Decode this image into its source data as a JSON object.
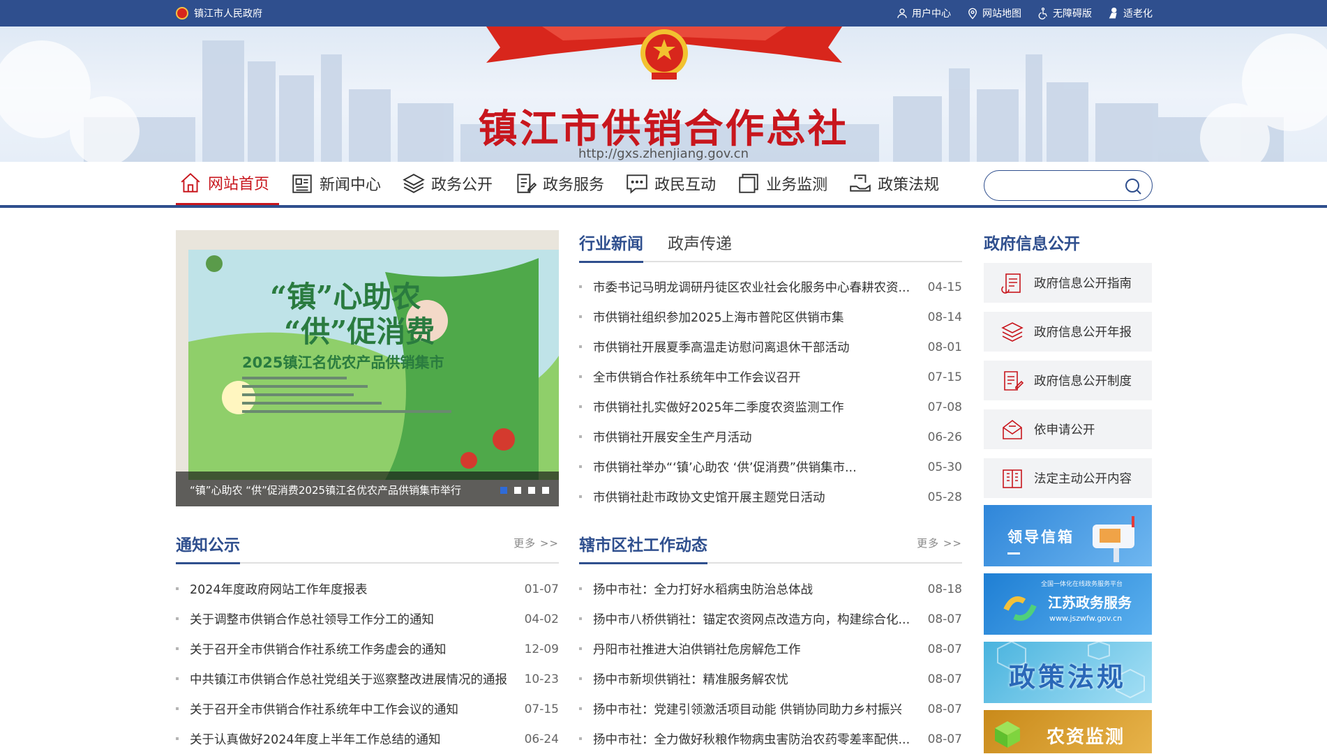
{
  "topbar": {
    "gov_label": "镇江市人民政府",
    "links": [
      "用户中心",
      "网站地图",
      "无障碍版",
      "适老化"
    ]
  },
  "banner": {
    "title": "镇江市供销合作总社",
    "url": "http://gxs.zhenjiang.gov.cn"
  },
  "nav": {
    "items": [
      "网站首页",
      "新闻中心",
      "政务公开",
      "政务服务",
      "政民互动",
      "业务监测",
      "政策法规"
    ],
    "search_placeholder": ""
  },
  "carousel": {
    "caption": "“镇”心助农 “供”促消费2025镇江名优农产品供销集市举行",
    "poster_line1": "“镇”心助农",
    "poster_line2": "“供”促消费",
    "poster_line3": "2025镇江名优农产品供销集市",
    "active_slide": 1,
    "slide_count": 4
  },
  "news": {
    "tabs": [
      "行业新闻",
      "政声传递"
    ],
    "items": [
      {
        "title": "市委书记马明龙调研丹徒区农业社会化服务中心春耕农资...",
        "date": "04-15"
      },
      {
        "title": "市供销社组织参加2025上海市普陀区供销市集",
        "date": "08-14"
      },
      {
        "title": "市供销社开展夏季高温走访慰问离退休干部活动",
        "date": "08-01"
      },
      {
        "title": "全市供销合作社系统年中工作会议召开",
        "date": "07-15"
      },
      {
        "title": "市供销社扎实做好2025年二季度农资监测工作",
        "date": "07-08"
      },
      {
        "title": "市供销社开展安全生产月活动",
        "date": "06-26"
      },
      {
        "title": "市供销社举办“‘镇’心助农 ‘供’促消费”供销集市...",
        "date": "05-30"
      },
      {
        "title": "市供销社赴市政协文史馆开展主题党日活动",
        "date": "05-28"
      }
    ]
  },
  "notices": {
    "title": "通知公示",
    "more": "更多 >>",
    "items": [
      {
        "title": "2024年度政府网站工作年度报表",
        "date": "01-07"
      },
      {
        "title": "关于调整市供销合作总社领导工作分工的通知",
        "date": "04-02"
      },
      {
        "title": "关于召开全市供销合作社系统工作务虚会的通知",
        "date": "12-09"
      },
      {
        "title": "中共镇江市供销合作总社党组关于巡察整改进展情况的通报",
        "date": "10-23"
      },
      {
        "title": "关于召开全市供销合作社系统年中工作会议的通知",
        "date": "07-15"
      },
      {
        "title": "关于认真做好2024年度上半年工作总结的通知",
        "date": "06-24"
      }
    ]
  },
  "district": {
    "title": "辖市区社工作动态",
    "more": "更多 >>",
    "items": [
      {
        "title": "扬中市社：全力打好水稻病虫防治总体战",
        "date": "08-18"
      },
      {
        "title": "扬中市八桥供销社：锚定农资网点改造方向，构建综合化...",
        "date": "08-07"
      },
      {
        "title": "丹阳市社推进大泊供销社危房解危工作",
        "date": "08-07"
      },
      {
        "title": "扬中市新坝供销社：精准服务解农忧",
        "date": "08-07"
      },
      {
        "title": "扬中市社：党建引领激活项目动能 供销协同助力乡村振兴",
        "date": "08-07"
      },
      {
        "title": "扬中市社：全力做好秋粮作物病虫害防治农药零差率配供...",
        "date": "08-07"
      }
    ]
  },
  "gov_info": {
    "title": "政府信息公开",
    "links": [
      "政府信息公开指南",
      "政府信息公开年报",
      "政府信息公开制度",
      "依申请公开",
      "法定主动公开内容"
    ]
  },
  "promos": {
    "mailbox": "领导信箱",
    "jszwfw": "江苏政务服务",
    "jszwfw_sub": "www.jszwfw.gov.cn",
    "jszwfw_top": "全国一体化在线政务服务平台",
    "policy": "政策法规",
    "farm": "农资监测"
  },
  "colors": {
    "primary": "#2f4f8e",
    "accent_red": "#c8161d"
  }
}
